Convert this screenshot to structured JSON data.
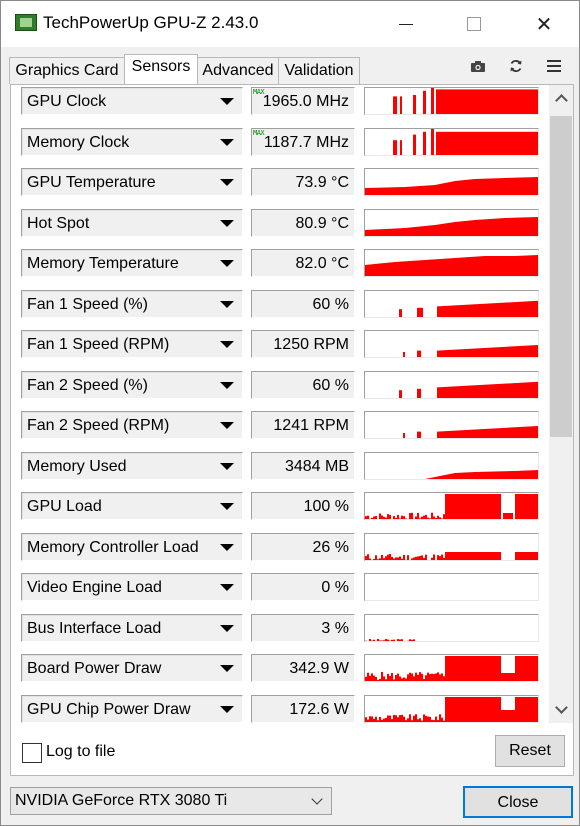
{
  "window": {
    "title": "TechPowerUp GPU-Z 2.43.0",
    "close_glyph": "✕"
  },
  "tabs": [
    {
      "label": "Graphics Card"
    },
    {
      "label": "Sensors"
    },
    {
      "label": "Advanced"
    },
    {
      "label": "Validation"
    }
  ],
  "toolbar": {
    "camera_icon": "camera-icon",
    "refresh_icon": "refresh-icon",
    "menu_icon": "hamburger-menu-icon"
  },
  "graph_color": "#ff0000",
  "sensors": [
    {
      "name": "GPU Clock",
      "value": "1965.0 MHz",
      "max_tag": "MAX"
    },
    {
      "name": "Memory Clock",
      "value": "1187.7 MHz",
      "max_tag": "MAX"
    },
    {
      "name": "GPU Temperature",
      "value": "73.9 °C"
    },
    {
      "name": "Hot Spot",
      "value": "80.9 °C"
    },
    {
      "name": "Memory Temperature",
      "value": "82.0 °C"
    },
    {
      "name": "Fan 1 Speed (%)",
      "value": "60 %"
    },
    {
      "name": "Fan 1 Speed (RPM)",
      "value": "1250 RPM"
    },
    {
      "name": "Fan 2 Speed (%)",
      "value": "60 %"
    },
    {
      "name": "Fan 2 Speed (RPM)",
      "value": "1241 RPM"
    },
    {
      "name": "Memory Used",
      "value": "3484 MB"
    },
    {
      "name": "GPU Load",
      "value": "100 %"
    },
    {
      "name": "Memory Controller Load",
      "value": "26 %"
    },
    {
      "name": "Video Engine Load",
      "value": "0 %"
    },
    {
      "name": "Bus Interface Load",
      "value": "3 %"
    },
    {
      "name": "Board Power Draw",
      "value": "342.9 W"
    },
    {
      "name": "GPU Chip Power Draw",
      "value": "172.6 W"
    }
  ],
  "log": {
    "label": "Log to file",
    "checked": false
  },
  "reset_label": "Reset",
  "gpu_select": {
    "selected": "NVIDIA GeForce RTX 3080 Ti"
  },
  "close_label": "Close"
}
